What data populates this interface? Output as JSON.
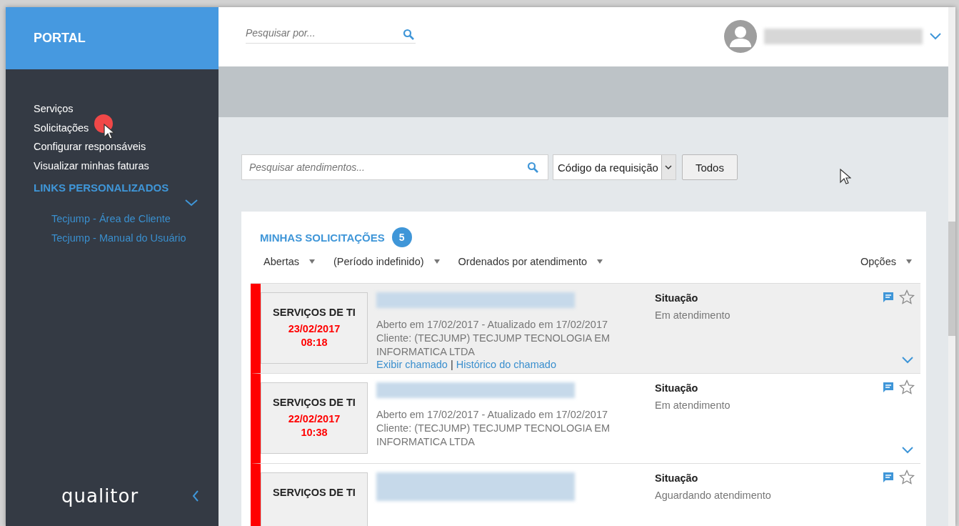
{
  "header": {
    "brand": "PORTAL",
    "search": {
      "placeholder": "Pesquisar por..."
    }
  },
  "sidebar": {
    "items": [
      {
        "label": "Serviços"
      },
      {
        "label": "Solicitações"
      },
      {
        "label": "Configurar responsáveis"
      },
      {
        "label": "Visualizar minhas faturas"
      }
    ],
    "section": {
      "title": "LINKS PERSONALIZADOS",
      "expanded": true,
      "links": [
        {
          "label": "Tecjump - Área de Cliente"
        },
        {
          "label": "Tecjump - Manual do Usuário"
        }
      ]
    },
    "logo": "qualitor"
  },
  "toolbar": {
    "search": {
      "placeholder": "Pesquisar atendimentos..."
    },
    "select": {
      "value": "Código da requisição"
    },
    "button": "Todos"
  },
  "card": {
    "title": "MINHAS SOLICITAÇÕES",
    "count": "5",
    "filters": [
      {
        "label": "Abertas"
      },
      {
        "label": "(Período indefinido)"
      },
      {
        "label": "Ordenados por atendimento"
      }
    ],
    "options": "Opções",
    "tickets": [
      {
        "highlighted": true,
        "category": "SERVIÇOS DE TI",
        "date": "23/02/2017",
        "time": "08:18",
        "meta": "Aberto em 17/02/2017 - Atualizado em 17/02/2017",
        "client": "Cliente: (TECJUMP) TECJUMP TECNOLOGIA EM INFORMATICA LTDA",
        "links": [
          "Exibir chamado",
          "Histórico do chamado"
        ],
        "link_separator": "|",
        "situation_label": "Situação",
        "status": "Em atendimento"
      },
      {
        "highlighted": false,
        "category": "SERVIÇOS DE TI",
        "date": "22/02/2017",
        "time": "10:38",
        "meta": "Aberto em 17/02/2017 - Atualizado em 17/02/2017",
        "client": "Cliente: (TECJUMP) TECJUMP TECNOLOGIA EM INFORMATICA LTDA",
        "situation_label": "Situação",
        "status": "Em atendimento"
      },
      {
        "highlighted": false,
        "category": "SERVIÇOS DE TI",
        "situation_label": "Situação",
        "status": "Aguardando atendimento"
      }
    ]
  }
}
